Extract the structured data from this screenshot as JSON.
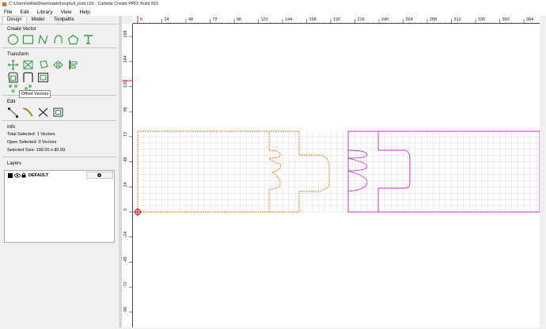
{
  "window": {
    "title": "C:\\Users\\willia\\Downloads\\longhull_joint.c2d - Carbide Create PRO; Build 815"
  },
  "menu": [
    "File",
    "Edit",
    "Library",
    "View",
    "Help"
  ],
  "tabs": [
    "Design",
    "Model",
    "Toolpaths"
  ],
  "sections": {
    "create_vector": "Create Vector",
    "transform": "Transform",
    "edit": "Edit",
    "info": "Info",
    "layers": "Layers"
  },
  "tooltip": "Offset Vectors",
  "info": {
    "total_selected": "Total Selected:  1 Vectors",
    "open_selected": "Open Selected:  0 Vectors",
    "selected_size": "Selected Size:  190.00 x 80.00"
  },
  "layer": {
    "name": "DEFAULT",
    "color": "#000000"
  },
  "hruler_ticks": [
    "0",
    "24",
    "48",
    "72",
    "96",
    "120",
    "144",
    "168",
    "192",
    "216",
    "240",
    "264",
    "288",
    "312",
    "336",
    "360",
    "384"
  ],
  "vruler_ticks": [
    "168",
    "144",
    "120",
    "96",
    "72",
    "48",
    "24",
    "0",
    "-24",
    "-48",
    "-72",
    "-96"
  ],
  "colors": {
    "accent_green": "#2e9e3e",
    "orange_path": "#e07a10",
    "magenta_path": "#d42ad4",
    "origin_red": "#e02020"
  },
  "icons": {
    "create": [
      "circle-icon",
      "rectangle-icon",
      "polyline-icon",
      "curve-icon",
      "polygon-icon",
      "text-icon"
    ],
    "transform_row1": [
      "move-icon",
      "scale-icon",
      "rotate-icon",
      "mirror-icon",
      "align-icon"
    ],
    "transform_row2": [
      "offset-vectors-icon",
      "join-icon",
      "weld-icon"
    ],
    "transform_row3": [
      "array-icon",
      "fillet-icon"
    ],
    "edit": [
      "node-edit-icon",
      "smooth-icon",
      "trim-icon",
      "bounding-box-icon"
    ]
  }
}
